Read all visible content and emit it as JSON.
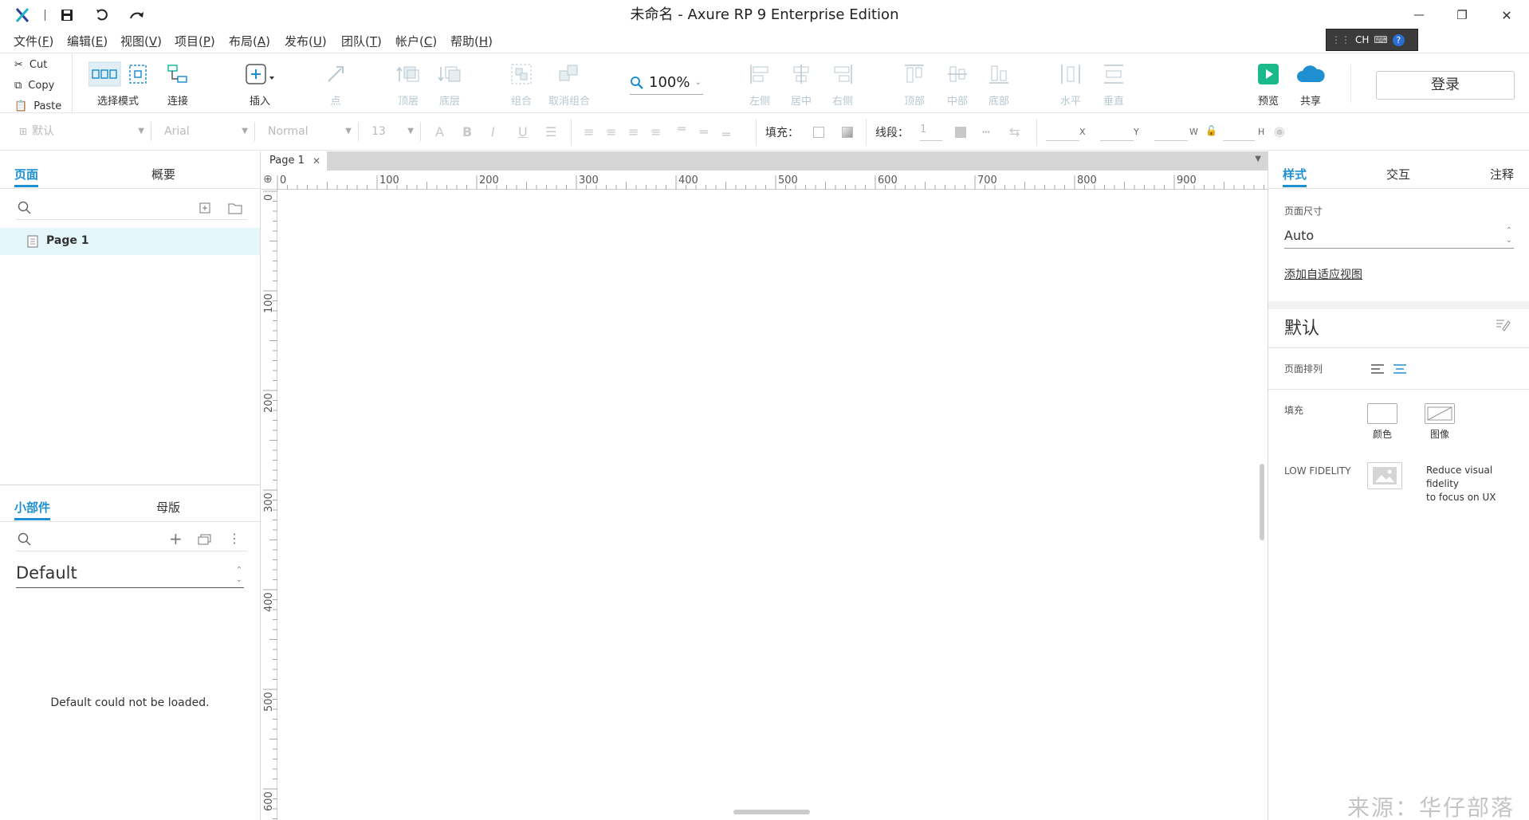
{
  "window": {
    "title": "未命名 - Axure RP 9 Enterprise Edition",
    "minimize": "—",
    "restore": "❐",
    "close": "✕"
  },
  "menu": [
    {
      "label": "文件(",
      "key": "F",
      "end": ")"
    },
    {
      "label": "编辑(",
      "key": "E",
      "end": ")"
    },
    {
      "label": "视图(",
      "key": "V",
      "end": ")"
    },
    {
      "label": "项目(",
      "key": "P",
      "end": ")"
    },
    {
      "label": "布局(",
      "key": "A",
      "end": ")"
    },
    {
      "label": "发布(",
      "key": "U",
      "end": ")"
    },
    {
      "label": "团队(",
      "key": "T",
      "end": ")"
    },
    {
      "label": "帐户(",
      "key": "C",
      "end": ")"
    },
    {
      "label": "帮助(",
      "key": "H",
      "end": ")"
    }
  ],
  "ime": {
    "text": "CH"
  },
  "clipboard": {
    "cut": "Cut",
    "copy": "Copy",
    "paste": "Paste"
  },
  "toolbar": {
    "select_mode": "选择模式",
    "connect": "连接",
    "insert": "插入",
    "point": "点",
    "zoom": "100%",
    "top_layer": "顶层",
    "bottom_layer": "底层",
    "group": "组合",
    "ungroup": "取消组合",
    "align_left": "左侧",
    "align_center": "居中",
    "align_right": "右侧",
    "align_top": "顶部",
    "align_middle": "中部",
    "align_bottom": "底部",
    "distribute_h": "水平",
    "distribute_v": "垂直",
    "preview": "预览",
    "share": "共享",
    "login": "登录"
  },
  "format": {
    "style": "默认",
    "font": "Arial",
    "weight": "Normal",
    "size": "13",
    "fill_label": "填充：",
    "line_label": "线段：",
    "line_value": "1",
    "x": "X",
    "y": "Y",
    "w": "W",
    "h": "H"
  },
  "pages_panel": {
    "tab_pages": "页面",
    "tab_outline": "概要",
    "page1": "Page 1"
  },
  "widgets_panel": {
    "tab_widgets": "小部件",
    "tab_masters": "母版",
    "library": "Default",
    "error": "Default could not be loaded."
  },
  "canvas": {
    "tab": "Page 1",
    "ruler_h": [
      "0",
      "100",
      "200",
      "300",
      "400",
      "500",
      "600",
      "700",
      "800",
      "900"
    ],
    "ruler_v": [
      "0",
      "100",
      "200",
      "300",
      "400",
      "500",
      "600"
    ]
  },
  "right_panel": {
    "tab_style": "样式",
    "tab_interaction": "交互",
    "tab_notes": "注释",
    "page_size_label": "页面尺寸",
    "page_size_value": "Auto",
    "add_adaptive": "添加自适应视图",
    "style_name": "默认",
    "page_align_label": "页面排列",
    "fill_label": "填充",
    "fill_color": "颜色",
    "fill_image": "图像",
    "low_fidelity": "LOW FIDELITY",
    "low_fidelity_desc1": "Reduce visual fidelity",
    "low_fidelity_desc2": "to focus on UX"
  },
  "watermark": "来源：华仔部落",
  "colors": {
    "accent": "#1e90d2",
    "axure_teal": "#21b6c6",
    "preview_green": "#1ab98a",
    "selection": "#e5f7fa"
  }
}
